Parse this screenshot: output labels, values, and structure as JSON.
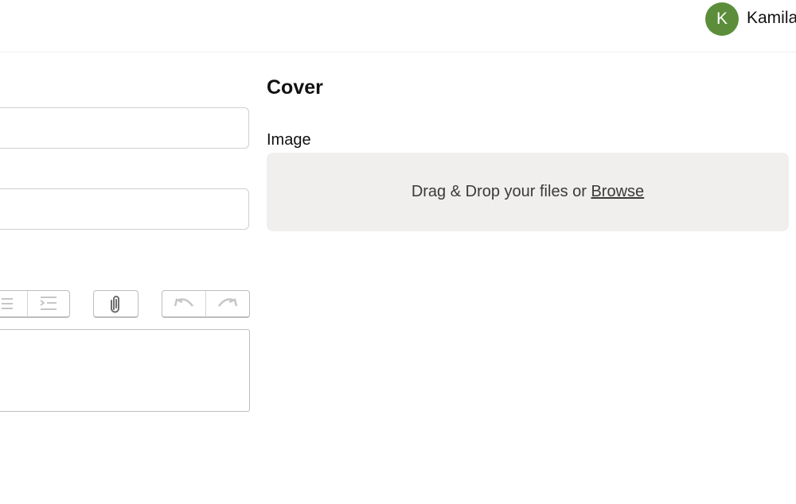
{
  "header": {
    "avatar_initial": "K",
    "user_name": "Kamila",
    "avatar_color": "#5b8d3a"
  },
  "form": {
    "field_1_value": "",
    "field_2_value": "",
    "editor_value": ""
  },
  "toolbar": {
    "icons": [
      "bullet-list-icon",
      "indent-icon",
      "paperclip-icon",
      "undo-icon",
      "redo-icon"
    ]
  },
  "cover": {
    "heading": "Cover",
    "image_label": "Image",
    "dropzone_text": "Drag & Drop your files or",
    "browse_label": "Browse",
    "dropzone_bg": "#f0efed"
  }
}
